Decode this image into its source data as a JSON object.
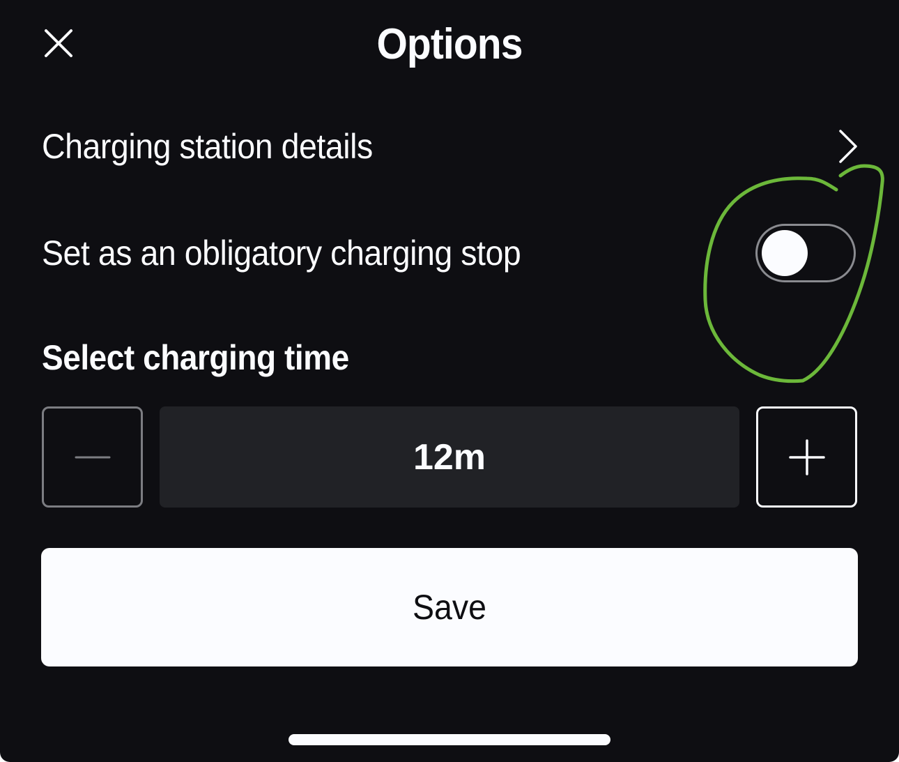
{
  "header": {
    "title": "Options",
    "close_icon": "close-icon"
  },
  "options": {
    "station_details_label": "Charging station details",
    "station_details_icon": "chevron-right-icon",
    "obligatory_stop_label": "Set as an obligatory charging stop",
    "obligatory_stop_enabled": false
  },
  "charging_time": {
    "heading": "Select charging time",
    "value": "12m",
    "decrement_icon": "minus-icon",
    "increment_icon": "plus-icon",
    "decrement_enabled": false
  },
  "save": {
    "label": "Save"
  },
  "colors": {
    "background": "#0e0e12",
    "text": "#fbfcff",
    "value_field": "#212226",
    "annotation": "#6cb83a"
  }
}
